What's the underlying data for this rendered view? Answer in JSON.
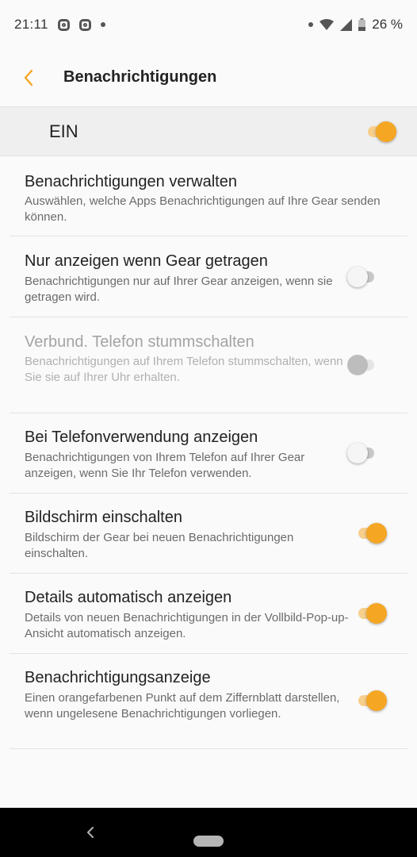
{
  "status_bar": {
    "time": "21:11",
    "battery": "26 %",
    "icons": [
      "notification-icon",
      "notification-icon",
      "dot-icon",
      "dot-icon",
      "wifi-icon",
      "signal-icon",
      "battery-icon"
    ]
  },
  "header": {
    "title": "Benachrichtigungen",
    "back_icon": "chevron-left-icon"
  },
  "master": {
    "label": "EIN",
    "on": true
  },
  "settings": [
    {
      "title": "Benachrichtigungen verwalten",
      "description": "Auswählen, welche Apps Benachrichtigungen auf Ihre Gear senden können."
    },
    {
      "title": "Nur anzeigen wenn Gear getragen",
      "description": "Benachrichtigungen nur auf Ihrer Gear anzeigen, wenn sie getragen wird.",
      "on": false
    },
    {
      "title": "Verbund. Telefon stummschalten",
      "description": "Benachrichtigungen auf Ihrem Telefon stummschalten, wenn Sie sie auf Ihrer Uhr erhalten.",
      "on": false,
      "enabled": false
    },
    {
      "title": "Bei Telefonverwendung anzeigen",
      "description": "Benachrichtigungen von Ihrem Telefon auf Ihrer Gear anzeigen, wenn Sie Ihr Telefon verwenden.",
      "on": false
    },
    {
      "title": "Bildschirm einschalten",
      "description": "Bildschirm der Gear bei neuen Benachrichtigungen einschalten.",
      "on": true
    },
    {
      "title": "Details automatisch anzeigen",
      "description": "Details von neuen Benachrichtigungen in der Vollbild-Pop-up-Ansicht automatisch anzeigen.",
      "on": true
    },
    {
      "title": "Benachrichtigungsanzeige",
      "description": "Einen orangefarbenen Punkt auf dem Ziffernblatt darstellen, wenn ungelesene Benachrichtigungen vorliegen.",
      "on": true
    }
  ],
  "colors": {
    "accent": "#f5a623",
    "accent_track": "#f7cf8d",
    "background": "#fafafa",
    "master_background": "#efefef"
  }
}
